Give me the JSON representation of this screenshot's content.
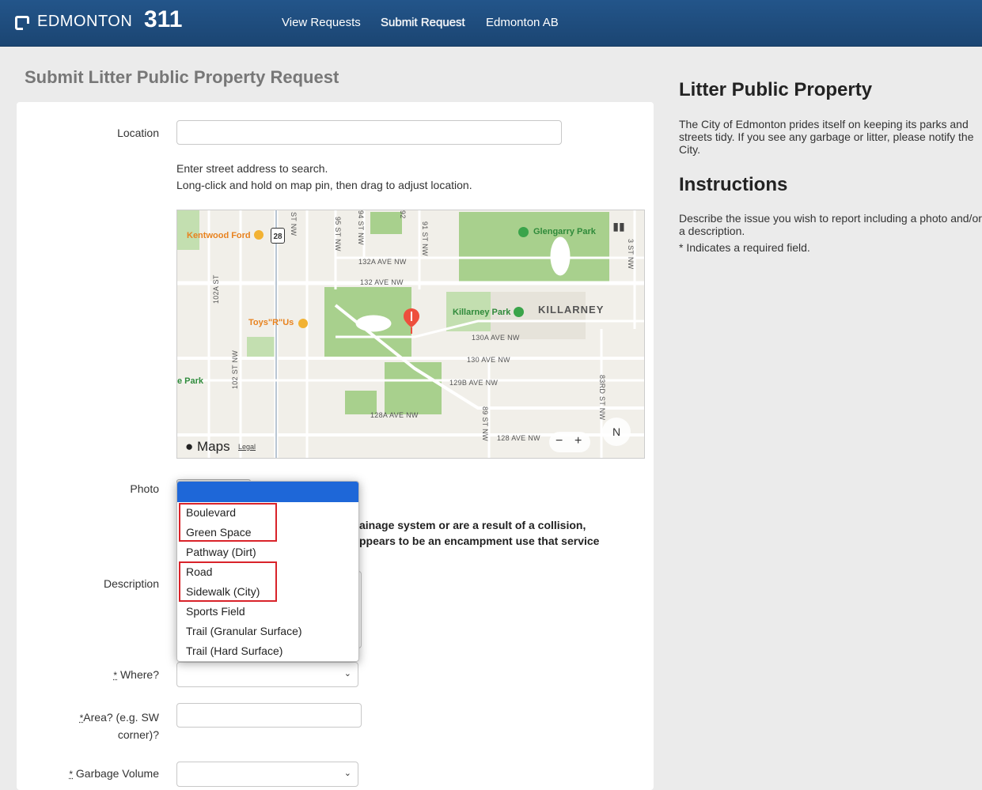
{
  "header": {
    "brand_text": "EDMONTON",
    "brand_number": "311",
    "nav": [
      "View Requests",
      "Submit Request",
      "Edmonton AB"
    ]
  },
  "page": {
    "title": "Submit Litter Public Property Request"
  },
  "form": {
    "location_label": "Location",
    "location_value": "",
    "location_help_1": "Enter street address to search.",
    "location_help_2": "Long-click and hold on map pin, then drag to adjust location.",
    "photo_label": "Photo",
    "notice_line_1": "ainage system or are a result of a collision,",
    "notice_line_2": "ppears to be an encampment use that service",
    "description_label": "Description",
    "required_marker": "*",
    "where_label": "Where?",
    "area_label_1": "Area? (e.g. SW",
    "area_label_2": "corner)?",
    "area_value": "",
    "garbage_label": "Garbage Volume"
  },
  "map": {
    "streets": [
      "ST NW",
      "95 ST NW",
      "94 ST NW",
      "92",
      "91 ST NW",
      "3 ST NW",
      "132A AVE NW",
      "132 AVE NW",
      "102A ST",
      "102 ST NW",
      "130A AVE NW",
      "130 AVE NW",
      "129B AVE NW",
      "128A AVE NW",
      "89 ST NW",
      "128 AVE NW",
      "83RD ST NW"
    ],
    "pois": [
      "Kentwood Ford",
      "Glengarry Park",
      "Toys\"R\"Us",
      "Killarney Park",
      "e Park"
    ],
    "neighbourhood": "KILLARNEY",
    "route_shield": "28",
    "logo": "Maps",
    "legal": "Legal",
    "zoom_out": "−",
    "zoom_in": "+",
    "compass": "N"
  },
  "where_dropdown": {
    "options": [
      "Boulevard",
      "Green Space",
      "Pathway (Dirt)",
      "Road",
      "Sidewalk (City)",
      "Sports Field",
      "Trail (Granular Surface)",
      "Trail (Hard Surface)"
    ]
  },
  "sidebar": {
    "title": "Litter Public Property",
    "description": "The City of Edmonton prides itself on keeping its parks and streets tidy. If you see any garbage or litter, please notify the City.",
    "instructions_title": "Instructions",
    "instructions_text": "Describe the issue you wish to report including a photo and/or a description.",
    "required_note": "* Indicates a required field."
  },
  "colors": {
    "header_bg": "#1f4e79",
    "dropdown_highlight": "#1e67d8",
    "annotation_red": "#d9232a",
    "map_park": "#a8d08d",
    "map_pin": "#ee4f3d"
  }
}
